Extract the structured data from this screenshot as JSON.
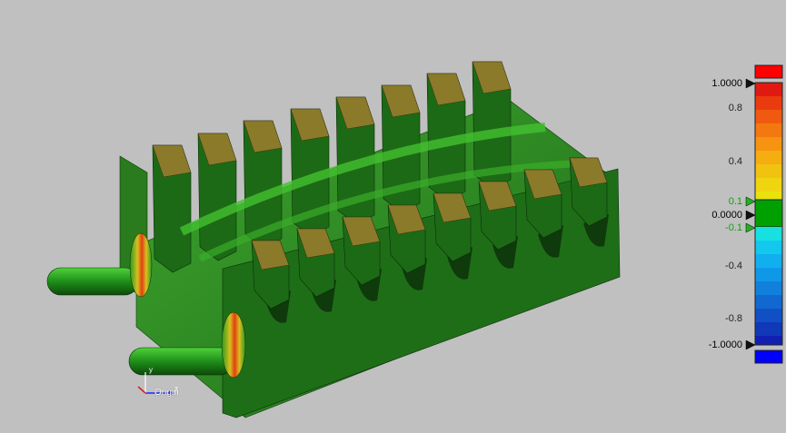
{
  "viewport": {
    "background": "#c0c0c0",
    "model_color": "#1f7a1a",
    "origin_label": "Origin",
    "axis_z_label": "z",
    "axis_y_label": "y"
  },
  "legend": {
    "max_label": "1.0000",
    "zero_label": "0.0000",
    "min_label": "-1.0000",
    "tick_0_8": "0.8",
    "tick_0_4": "0.4",
    "tick_0_1": "0.1",
    "tick_m0_1": "-0.1",
    "tick_m0_4": "-0.4",
    "tick_m0_8": "-0.8",
    "over_color": "#ff0000",
    "under_color": "#0000ff",
    "neutral_color": "#00a000"
  }
}
